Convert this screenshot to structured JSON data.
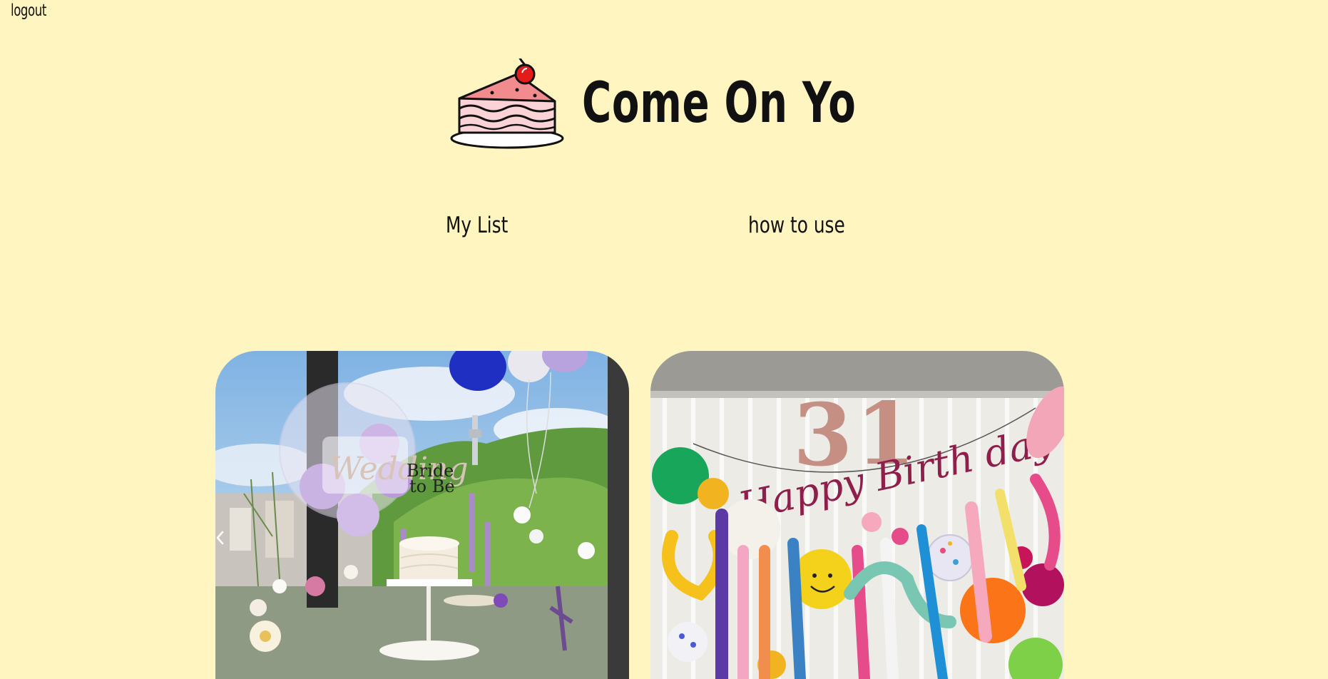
{
  "header": {
    "logout_label": "logout",
    "brand_title": "Come On Yo",
    "brand_icon": "cake-slice-icon"
  },
  "nav": {
    "items": [
      {
        "label": "My List"
      },
      {
        "label": "how to use"
      }
    ]
  },
  "gallery": {
    "cards": [
      {
        "theme": "wedding-party",
        "image": "bride-to-be-table-photo"
      },
      {
        "theme": "birthday-party",
        "image": "happy-birthday-balloons-photo"
      }
    ]
  },
  "colors": {
    "background": "#fff5c0",
    "text": "#111111"
  }
}
